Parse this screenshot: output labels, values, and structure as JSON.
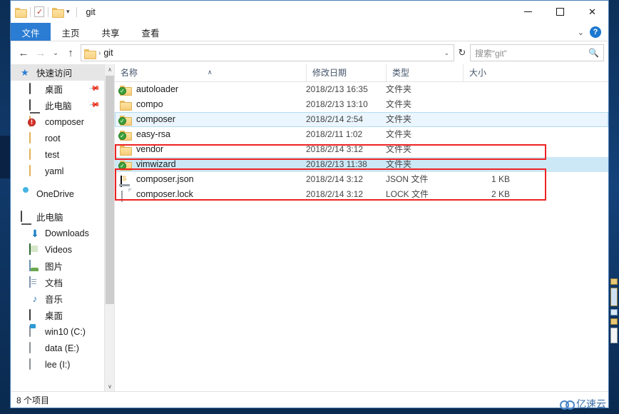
{
  "window": {
    "title": "git",
    "quick_access_toolbar": [
      {
        "name": "folder-icon",
        "label": ""
      },
      {
        "name": "properties-icon",
        "label": ""
      },
      {
        "name": "new-folder-icon",
        "label": ""
      },
      {
        "name": "customize-caret-icon",
        "label": "▾"
      }
    ],
    "controls": {
      "minimize": "─",
      "maximize": "□",
      "close": "✕"
    }
  },
  "ribbon": {
    "tabs": [
      {
        "label": "文件",
        "active": true
      },
      {
        "label": "主页",
        "active": false
      },
      {
        "label": "共享",
        "active": false
      },
      {
        "label": "查看",
        "active": false
      }
    ],
    "expand_caret": "⌄",
    "help_label": "?"
  },
  "navigation": {
    "back": "←",
    "forward": "→",
    "recent": "⌄",
    "up": "↑",
    "refresh": "↻",
    "address_caret": "⌄",
    "breadcrumbs": [
      {
        "icon": "folder-icon",
        "label": ""
      },
      {
        "label": "git"
      }
    ],
    "crumb_separator": "›"
  },
  "search": {
    "placeholder": "搜索“git”",
    "icon": "search-icon"
  },
  "sidebar": {
    "groups": [
      {
        "header": {
          "label": "快速访问",
          "icon": "star-pin-icon",
          "highlighted": true
        },
        "items": [
          {
            "label": "桌面",
            "icon": "desktop-icon",
            "pinned": true,
            "indent": 1
          },
          {
            "label": "此电脑",
            "icon": "this-pc-icon",
            "pinned": true,
            "indent": 1
          },
          {
            "label": "composer",
            "icon": "folder-error-icon",
            "badge": "!",
            "indent": 1
          },
          {
            "label": "root",
            "icon": "folder-icon",
            "indent": 1
          },
          {
            "label": "test",
            "icon": "folder-icon",
            "indent": 1
          },
          {
            "label": "yaml",
            "icon": "folder-icon",
            "indent": 1
          }
        ]
      },
      {
        "header": {
          "label": "OneDrive",
          "icon": "onedrive-icon",
          "highlighted": false
        },
        "items": []
      },
      {
        "header": {
          "label": "此电脑",
          "icon": "this-pc-icon",
          "highlighted": false
        },
        "items": [
          {
            "label": "Downloads",
            "icon": "downloads-icon",
            "indent": 1
          },
          {
            "label": "Videos",
            "icon": "videos-icon",
            "indent": 1
          },
          {
            "label": "图片",
            "icon": "pictures-icon",
            "indent": 1
          },
          {
            "label": "文档",
            "icon": "documents-icon",
            "indent": 1
          },
          {
            "label": "音乐",
            "icon": "music-icon",
            "indent": 1
          },
          {
            "label": "桌面",
            "icon": "desktop-icon",
            "indent": 1
          },
          {
            "label": "win10 (C:)",
            "icon": "windows-drive-icon",
            "indent": 1
          },
          {
            "label": "data (E:)",
            "icon": "drive-icon",
            "indent": 1
          },
          {
            "label": "lee (I:)",
            "icon": "drive-icon",
            "indent": 1
          }
        ]
      }
    ],
    "scroll": {
      "up_arrow": "∧",
      "down_arrow": "∨"
    }
  },
  "filelist": {
    "columns": [
      {
        "key": "name",
        "label": "名称",
        "sorted": true,
        "sort_caret": "∧"
      },
      {
        "key": "date",
        "label": "修改日期"
      },
      {
        "key": "type",
        "label": "类型"
      },
      {
        "key": "size",
        "label": "大小"
      }
    ],
    "rows": [
      {
        "name": "autoloader",
        "date": "2018/2/13 16:35",
        "type": "文件夹",
        "size": "",
        "icon": "folder-icon",
        "overlay": "sync-ok-icon",
        "state": "normal"
      },
      {
        "name": "compo",
        "date": "2018/2/13 13:10",
        "type": "文件夹",
        "size": "",
        "icon": "folder-icon",
        "overlay": "",
        "state": "normal"
      },
      {
        "name": "composer",
        "date": "2018/2/14 2:54",
        "type": "文件夹",
        "size": "",
        "icon": "folder-icon",
        "overlay": "sync-ok-icon",
        "state": "hovered"
      },
      {
        "name": "easy-rsa",
        "date": "2018/2/11 1:02",
        "type": "文件夹",
        "size": "",
        "icon": "folder-icon",
        "overlay": "sync-ok-icon",
        "state": "normal"
      },
      {
        "name": "vendor",
        "date": "2018/2/14 3:12",
        "type": "文件夹",
        "size": "",
        "icon": "folder-icon",
        "overlay": "",
        "state": "normal"
      },
      {
        "name": "vimwizard",
        "date": "2018/2/13 11:38",
        "type": "文件夹",
        "size": "",
        "icon": "folder-icon",
        "overlay": "sync-ok-icon",
        "state": "selected"
      },
      {
        "name": "composer.json",
        "date": "2018/2/14 3:12",
        "type": "JSON 文件",
        "size": "1 KB",
        "icon": "json-file-icon",
        "overlay": "",
        "state": "normal"
      },
      {
        "name": "composer.lock",
        "date": "2018/2/14 3:12",
        "type": "LOCK 文件",
        "size": "2 KB",
        "icon": "generic-file-icon",
        "overlay": "",
        "state": "normal"
      }
    ],
    "annotations": [
      {
        "name": "highlight-vendor",
        "color": "#ee2222"
      },
      {
        "name": "highlight-composer-files",
        "color": "#ee2222"
      }
    ]
  },
  "statusbar": {
    "item_count_label": "8 个项目"
  },
  "watermark": {
    "label": "亿速云"
  }
}
